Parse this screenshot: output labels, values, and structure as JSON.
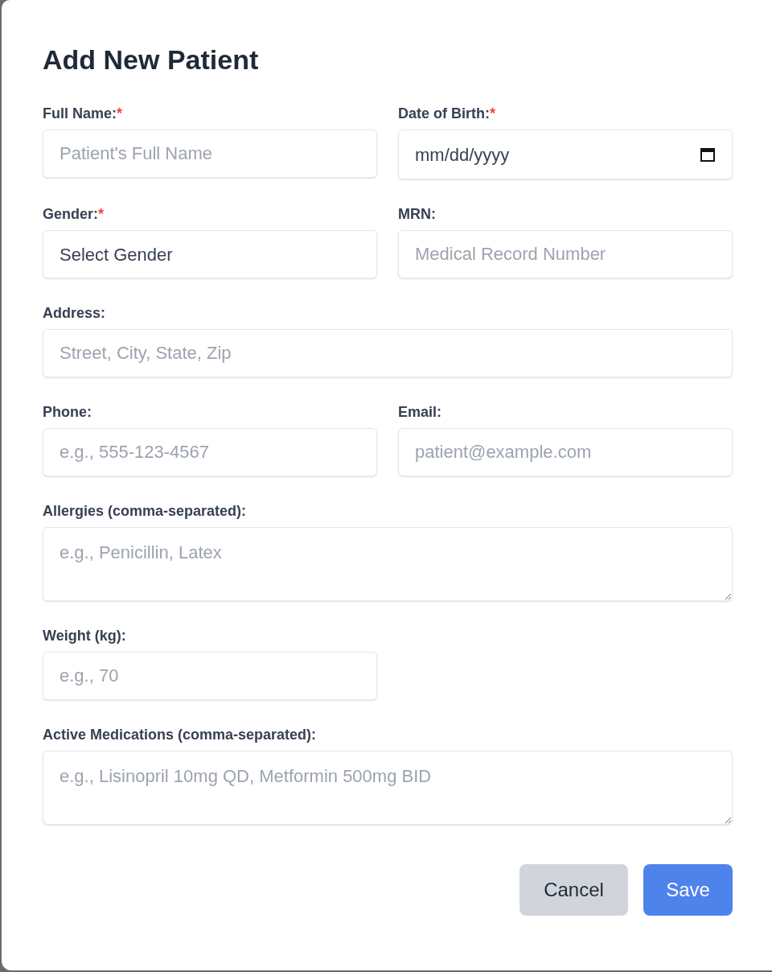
{
  "dialog": {
    "title": "Add New Patient"
  },
  "fields": [
    {
      "label": "Full Name:",
      "required_mark": "*",
      "kind": "text",
      "placeholder": "Patient's Full Name",
      "wide": false
    },
    {
      "label": "Date of Birth:",
      "required_mark": "*",
      "kind": "date",
      "value": "mm/dd/yyyy",
      "wide": false
    },
    {
      "label": "Gender:",
      "required_mark": "*",
      "kind": "select",
      "value": "Select Gender",
      "wide": false
    },
    {
      "label": "MRN:",
      "kind": "text",
      "placeholder": "Medical Record Number",
      "wide": false
    },
    {
      "label": "Address:",
      "kind": "text",
      "placeholder": "Street, City, State, Zip",
      "wide": true
    },
    {
      "label": "Phone:",
      "kind": "text",
      "placeholder": "e.g., 555-123-4567",
      "wide": false
    },
    {
      "label": "Email:",
      "kind": "text",
      "placeholder": "patient@example.com",
      "wide": false
    },
    {
      "label": "Allergies (comma-separated):",
      "kind": "textarea",
      "placeholder": "e.g., Penicillin, Latex",
      "wide": true
    },
    {
      "label": "Weight (kg):",
      "kind": "text",
      "placeholder": "e.g., 70",
      "wide": false
    },
    {
      "label": "Active Medications (comma-separated):",
      "kind": "textarea",
      "placeholder": "e.g., Lisinopril 10mg QD, Metformin 500mg BID",
      "wide": true
    }
  ],
  "buttons": [
    {
      "label": "Cancel",
      "kind": "secondary"
    },
    {
      "label": "Save",
      "kind": "primary"
    }
  ]
}
